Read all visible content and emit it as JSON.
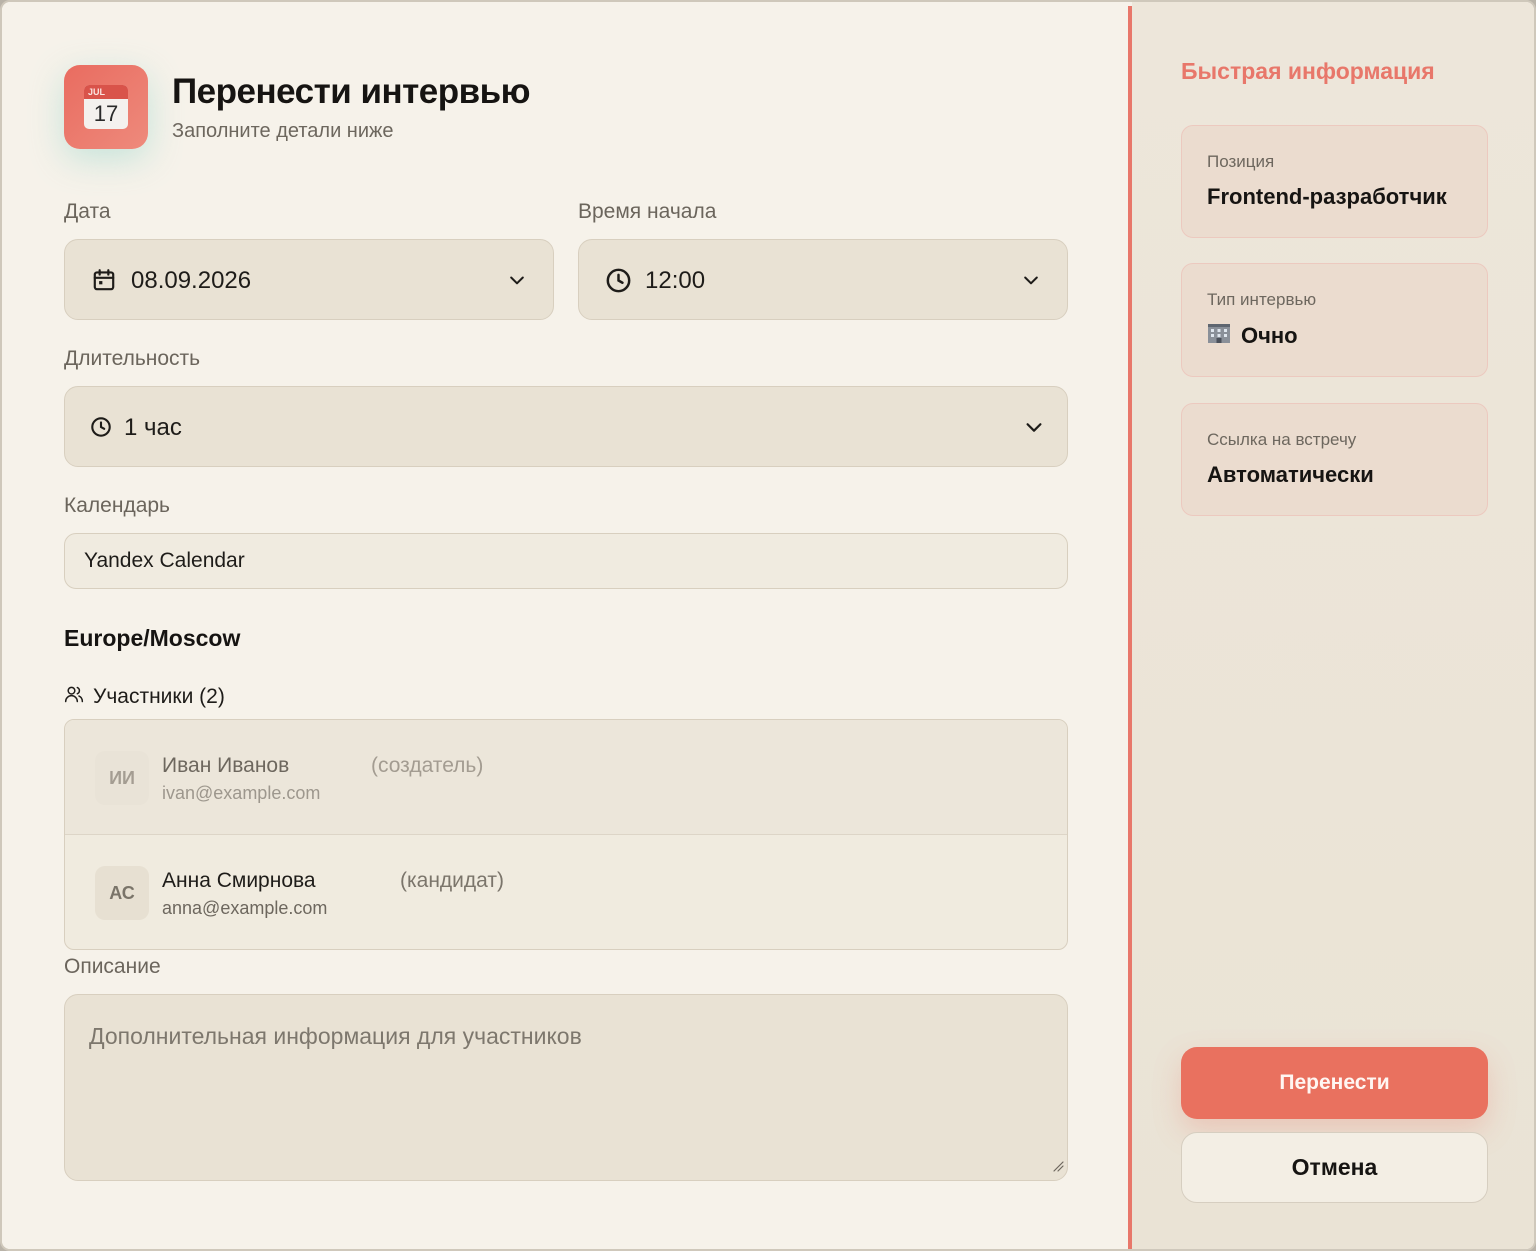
{
  "header": {
    "icon_month": "JUL",
    "icon_day": "17",
    "title": "Перенести интервью",
    "subtitle": "Заполните детали ниже"
  },
  "form": {
    "date": {
      "label": "Дата",
      "value": "08.09.2026"
    },
    "start_time": {
      "label": "Время начала",
      "value": "12:00"
    },
    "duration": {
      "label": "Длительность",
      "value": "1 час"
    },
    "calendar": {
      "label": "Календарь",
      "value": "Yandex Calendar"
    },
    "timezone": "Europe/Moscow",
    "participants": {
      "heading": "Участники (2)",
      "items": [
        {
          "initials": "ИИ",
          "name": "Иван Иванов",
          "role": "(создатель)",
          "email": "ivan@example.com"
        },
        {
          "initials": "АС",
          "name": "Анна Смирнова",
          "role": "(кандидат)",
          "email": "anna@example.com"
        }
      ]
    },
    "description": {
      "label": "Описание",
      "placeholder": "Дополнительная информация для участников"
    }
  },
  "sidebar": {
    "title": "Быстрая информация",
    "cards": [
      {
        "key": "Позиция",
        "value": "Frontend-разработчик"
      },
      {
        "key": "Тип интервью",
        "icon": "office-building-icon",
        "value": "Очно"
      },
      {
        "key": "Ссылка на встречу",
        "value": "Автоматически"
      }
    ],
    "primary_button": "Перенести",
    "secondary_button": "Отмена"
  },
  "colors": {
    "accent": "#e8776a",
    "background": "#f6f2ea",
    "field": "#e9e2d4",
    "sidebar": "#ede6da"
  }
}
